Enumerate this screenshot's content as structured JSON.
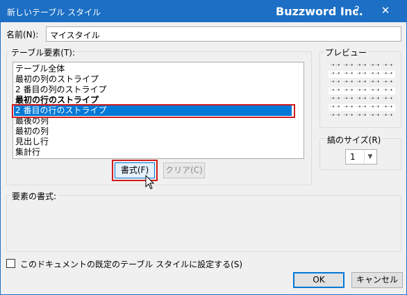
{
  "window": {
    "title": "新しいテーブル スタイル",
    "brand": "Buzzword Inc.",
    "help": "?",
    "close": "✕"
  },
  "name_field": {
    "label": "名前(N):",
    "value": "マイスタイル"
  },
  "elements_group": {
    "label": "テーブル要素(T):",
    "items": [
      {
        "label": "テーブル全体",
        "bold": false,
        "selected": false
      },
      {
        "label": "最初の列のストライプ",
        "bold": false,
        "selected": false
      },
      {
        "label": "2 番目の列のストライプ",
        "bold": false,
        "selected": false
      },
      {
        "label": "最初の行のストライプ",
        "bold": true,
        "selected": false
      },
      {
        "label": "2 番目の行のストライプ",
        "bold": false,
        "selected": true
      },
      {
        "label": "最後の列",
        "bold": false,
        "selected": false
      },
      {
        "label": "最初の列",
        "bold": false,
        "selected": false
      },
      {
        "label": "見出し行",
        "bold": false,
        "selected": false
      },
      {
        "label": "集計行",
        "bold": false,
        "selected": false
      }
    ],
    "format_button": "書式(F)",
    "clear_button": "クリア(C)"
  },
  "preview": {
    "label": "プレビュー"
  },
  "stripe_size": {
    "label": "縞のサイズ(R)",
    "value": "1"
  },
  "element_format": {
    "label": "要素の書式:"
  },
  "default_checkbox": {
    "label": "このドキュメントの既定のテーブル スタイルに設定する(S)",
    "checked": false
  },
  "footer": {
    "ok": "OK",
    "cancel": "キャンセル"
  }
}
